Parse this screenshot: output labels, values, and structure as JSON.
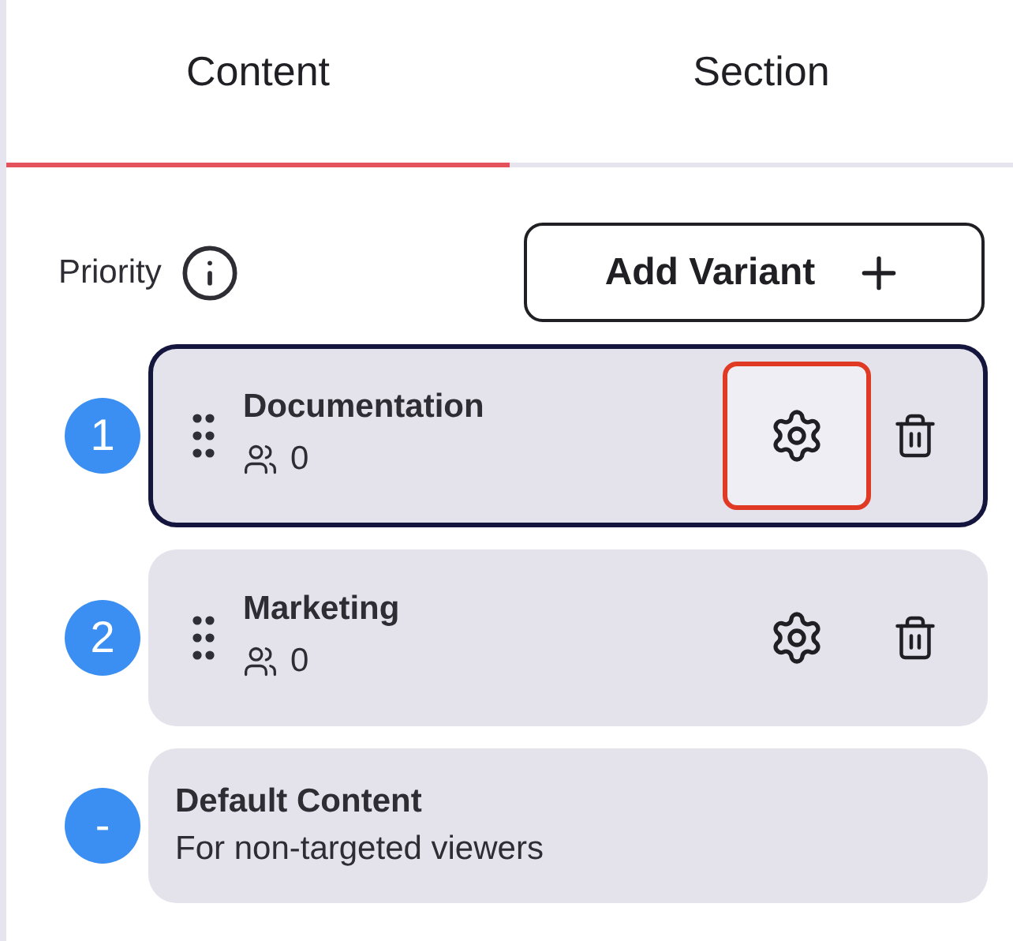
{
  "tabs": [
    {
      "label": "Content",
      "selected": true
    },
    {
      "label": "Section",
      "selected": false
    }
  ],
  "priority": {
    "label": "Priority"
  },
  "add_button": {
    "label": "Add Variant"
  },
  "variants": [
    {
      "kind": "variant",
      "badge": "1",
      "title": "Documentation",
      "viewers": "0",
      "selected": true,
      "settings_highlighted": true
    },
    {
      "kind": "variant",
      "badge": "2",
      "title": "Marketing",
      "viewers": "0",
      "selected": false,
      "settings_highlighted": false
    },
    {
      "kind": "default",
      "badge": "-",
      "title": "Default Content",
      "subtitle": "For non-targeted viewers",
      "selected": false
    }
  ]
}
